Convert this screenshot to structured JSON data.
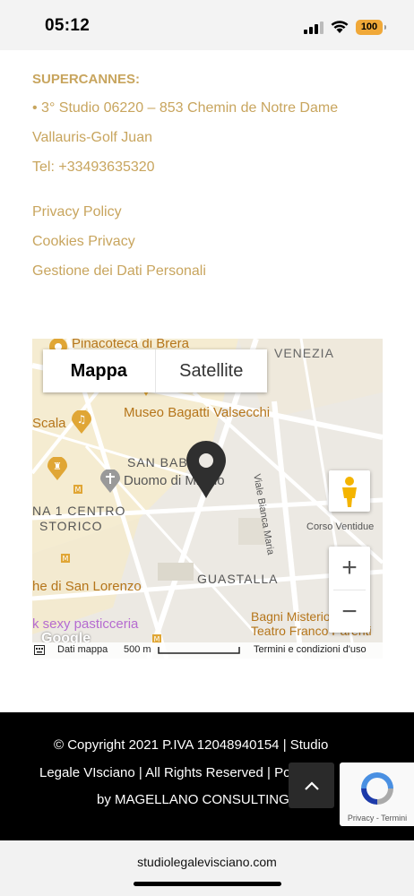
{
  "status_bar": {
    "time": "05:12",
    "battery": "100"
  },
  "contact": {
    "heading": "SUPERCANNES:",
    "address_line1": "• 3° Studio 06220 – 853 Chemin de Notre Dame",
    "address_line2": "Vallauris-Golf Juan",
    "phone": "Tel: +33493635320"
  },
  "links": {
    "privacy_policy": "Privacy Policy",
    "cookies_privacy": "Cookies Privacy",
    "data_management": "Gestione dei Dati Personali"
  },
  "map": {
    "tabs": {
      "map": "Mappa",
      "satellite": "Satellite"
    },
    "labels": {
      "pinacoteca": "Pinacoteca di Brera",
      "venezia": "VENEZIA",
      "museo": "Museo Bagatti Valsecchi",
      "scala": "Scala",
      "san_babila": "SAN BABILA",
      "duomo": "Duomo di Milano",
      "viale": "Viale Bianca Maria",
      "centro1": "NA 1 CENTRO",
      "centro2": "STORICO",
      "corso": "Corso Ventidue",
      "guastalla": "GUASTALLA",
      "lorenzo": "he di San Lorenzo",
      "bagni": "Bagni Misteriosi",
      "teatro": "Teatro Franco Parenti",
      "sexy": "k sexy pasticceria",
      "google": "Google"
    },
    "zoom_in": "+",
    "zoom_out": "−",
    "attribution": {
      "data": "Dati mappa",
      "scale": "500 m",
      "terms": "Termini e condizioni d'uso"
    }
  },
  "footer": {
    "line1": "© Copyright 2021 P.IVA 12048940154  |   Studio",
    "line2": "Legale VIsciano   |   All Rights Reserved   |   Pow",
    "line3": "by MAGELLANO CONSULTING SRL"
  },
  "recaptcha": {
    "links": "Privacy - Termini"
  },
  "browser": {
    "url": "studiolegalevisciano.com"
  }
}
